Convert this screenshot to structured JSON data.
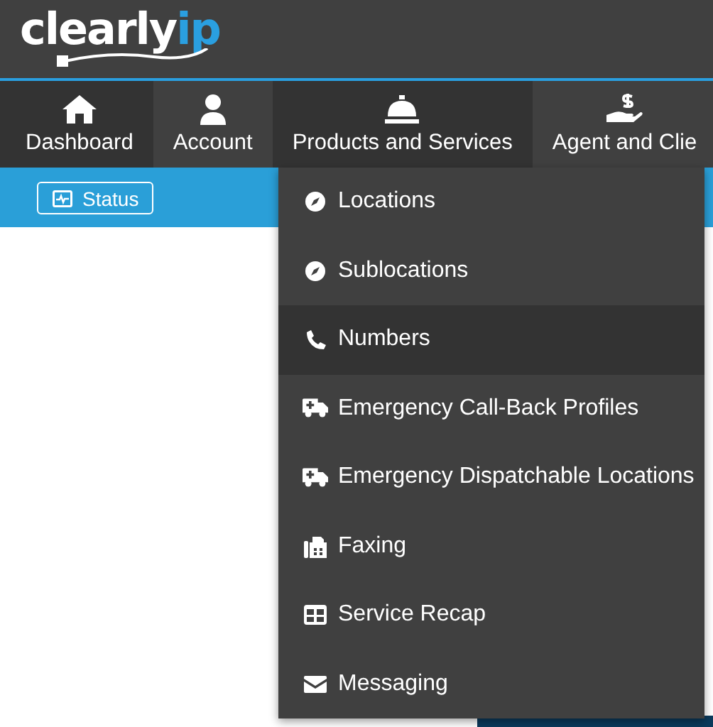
{
  "logo": {
    "word": "clearly",
    "accent": "ip"
  },
  "nav": [
    {
      "label": "Dashboard",
      "kind": "home",
      "highlighted": true
    },
    {
      "label": "Account",
      "kind": "user",
      "highlighted": false
    },
    {
      "label": "Products and Services",
      "kind": "bell",
      "highlighted": true
    },
    {
      "label": "Agent and Clie",
      "kind": "hand",
      "highlighted": false
    }
  ],
  "status_button": {
    "label": "Status"
  },
  "menu": [
    {
      "label": "Locations",
      "kind": "compass",
      "selected": false
    },
    {
      "label": "Sublocations",
      "kind": "compass",
      "selected": false
    },
    {
      "label": "Numbers",
      "kind": "phone",
      "selected": true
    },
    {
      "label": "Emergency Call-Back Profiles",
      "kind": "ambulance",
      "selected": false
    },
    {
      "label": "Emergency Dispatchable Locations",
      "kind": "ambulance",
      "selected": false
    },
    {
      "label": "Faxing",
      "kind": "fax",
      "selected": false
    },
    {
      "label": "Service Recap",
      "kind": "table",
      "selected": false
    },
    {
      "label": "Messaging",
      "kind": "envelope",
      "selected": false
    }
  ]
}
